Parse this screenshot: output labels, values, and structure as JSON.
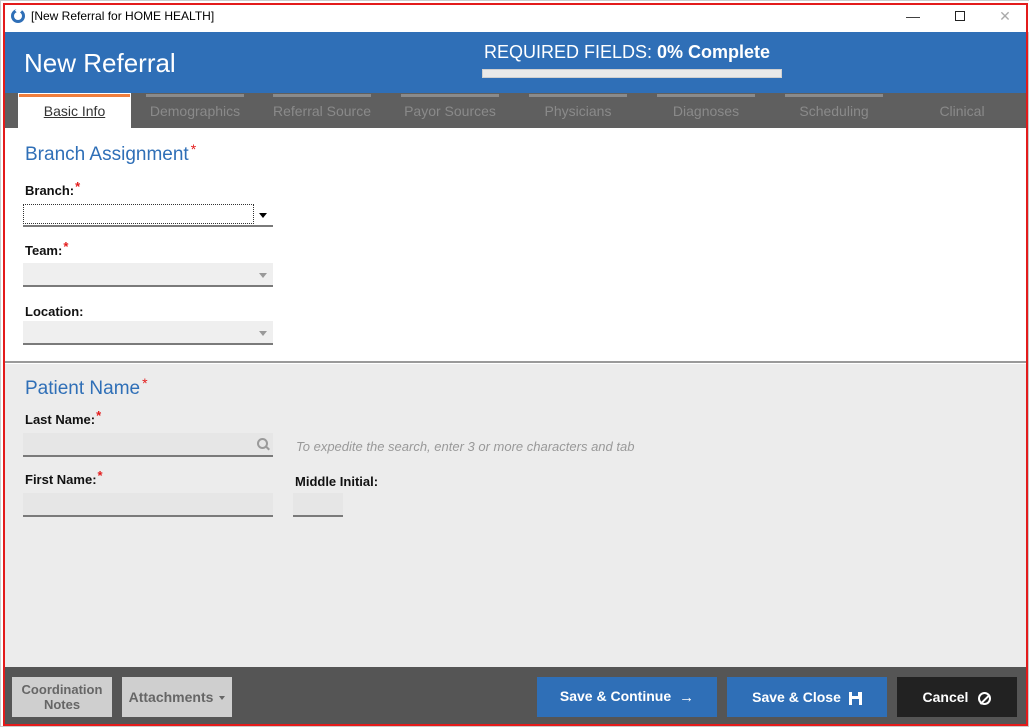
{
  "window": {
    "title": "[New Referral for HOME HEALTH]",
    "min_symbol": "—",
    "close_symbol": "✕"
  },
  "header": {
    "title": "New Referral",
    "required_prefix": "REQUIRED FIELDS: ",
    "required_value": "0% Complete",
    "progress_fraction": 0
  },
  "tabs": [
    {
      "label": "Basic Info",
      "state": "active"
    },
    {
      "label": "Demographics",
      "state": "enabled"
    },
    {
      "label": "Referral Source",
      "state": "enabled"
    },
    {
      "label": "Payor Sources",
      "state": "enabled"
    },
    {
      "label": "Physicians",
      "state": "enabled"
    },
    {
      "label": "Diagnoses",
      "state": "enabled"
    },
    {
      "label": "Scheduling",
      "state": "enabled"
    },
    {
      "label": "Clinical",
      "state": "disabled"
    }
  ],
  "branch_assignment": {
    "title": "Branch Assignment",
    "required_mark": "*",
    "branch_label": "Branch:",
    "branch_value": "",
    "team_label": "Team:",
    "team_value": "",
    "location_label": "Location:",
    "location_value": ""
  },
  "patient_name": {
    "title": "Patient Name",
    "required_mark": "*",
    "last_name_label": "Last Name:",
    "last_name_value": "",
    "search_hint": "To expedite the search, enter 3 or more characters and tab",
    "first_name_label": "First Name:",
    "first_name_value": "",
    "middle_initial_label": "Middle Initial:",
    "middle_initial_value": ""
  },
  "footer": {
    "coordination_notes": "Coordination Notes",
    "attachments": "Attachments",
    "save_continue": "Save & Continue",
    "save_continue_icon": "→",
    "save_close": "Save & Close",
    "cancel": "Cancel"
  },
  "colors": {
    "brand_blue": "#2f6fb7",
    "required_red": "#e31b1b",
    "active_tab_accent": "#f07e3c",
    "footer_bg": "#555555"
  }
}
